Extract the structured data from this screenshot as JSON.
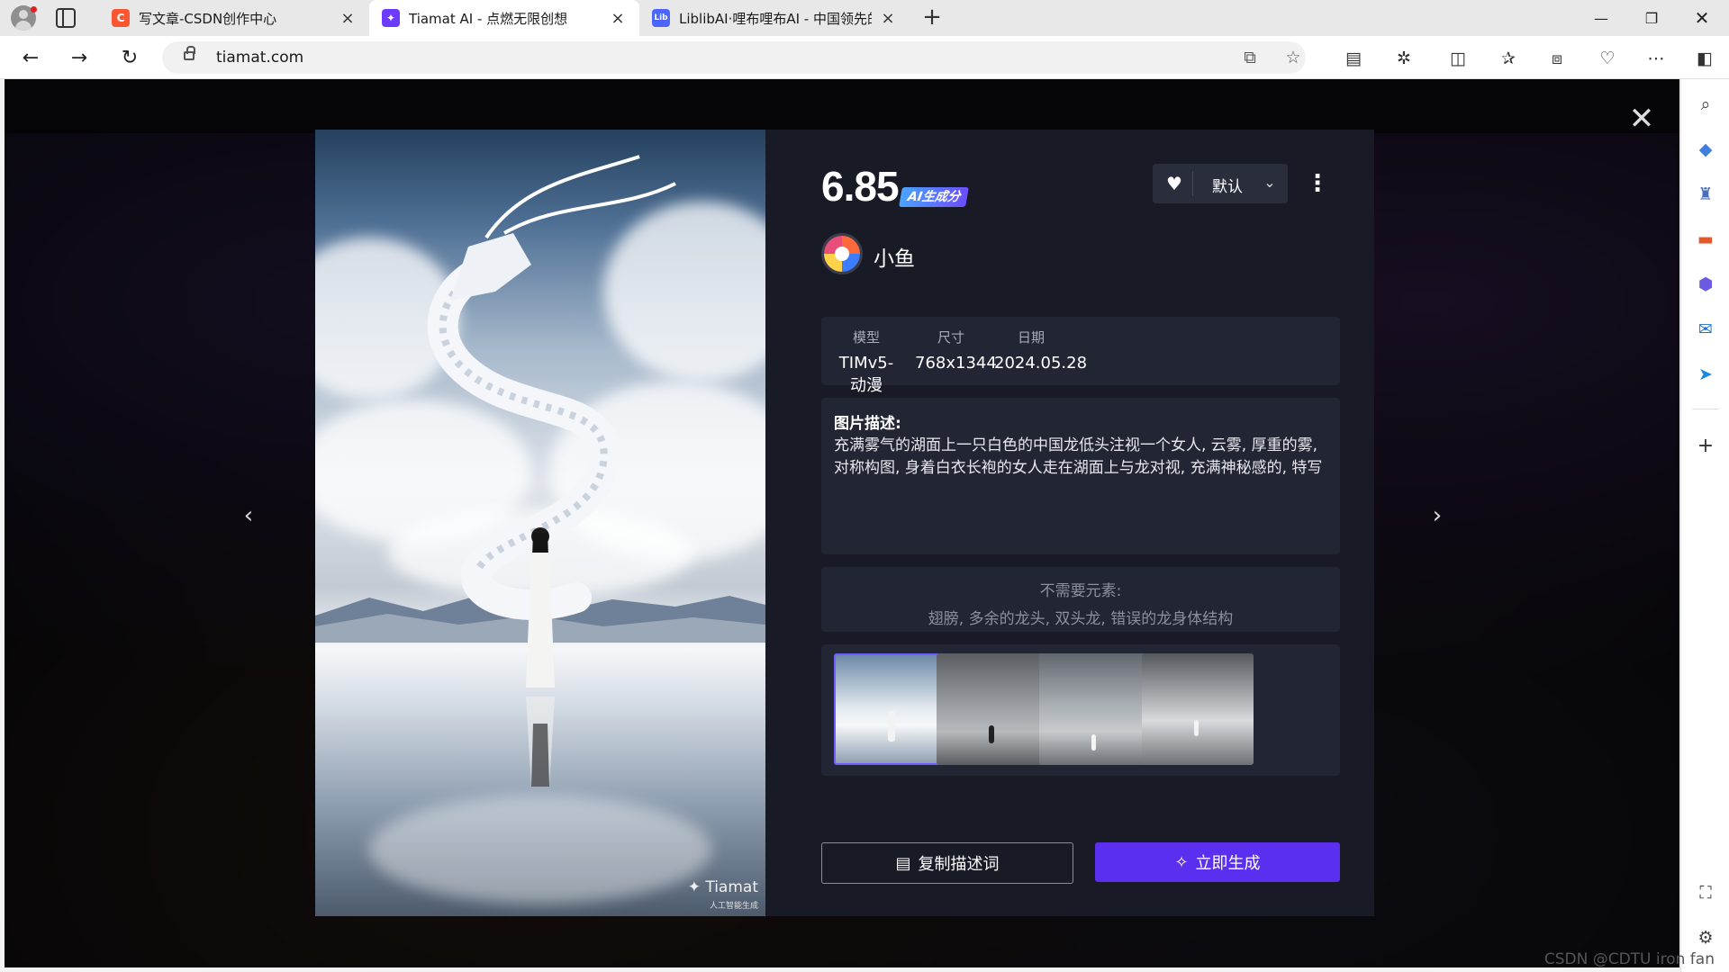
{
  "browser": {
    "tabs": [
      {
        "title": "写文章-CSDN创作中心",
        "favicon": "C",
        "favicon_color": "#fc5531"
      },
      {
        "title": "Tiamat AI - 点燃无限创想",
        "favicon": "✦",
        "favicon_color": "#6b3cff"
      },
      {
        "title": "LiblibAI·哩布哩布AI - 中国领先的",
        "favicon": "Lib",
        "favicon_color": "#4a66ff"
      }
    ],
    "url": "tiamat.com"
  },
  "modal": {
    "score": "6.85",
    "ai_badge": "AI生成分",
    "sort_label": "默认",
    "author": "小鱼",
    "meta": [
      {
        "label": "模型",
        "value": "TIMv5-动漫"
      },
      {
        "label": "尺寸",
        "value": "768x1344"
      },
      {
        "label": "日期",
        "value": "2024.05.28"
      }
    ],
    "description_label": "图片描述:",
    "description": "充满雾气的湖面上一只白色的中国龙低头注视一个女人, 云雾, 厚重的雾, 对称构图, 身着白衣长袍的女人走在湖面上与龙对视, 充满神秘感的, 特写",
    "negative_label": "不需要元素:",
    "negative": "翅膀, 多余的龙头, 双头龙, 错误的龙身体结构",
    "copy_button": "复制描述词",
    "generate_button": "立即生成",
    "watermark": "Tiamat",
    "watermark_sub": "人工智能生成",
    "accent_color": "#5b2ff0"
  },
  "footer_watermark": "CSDN @CDTU iron fan"
}
